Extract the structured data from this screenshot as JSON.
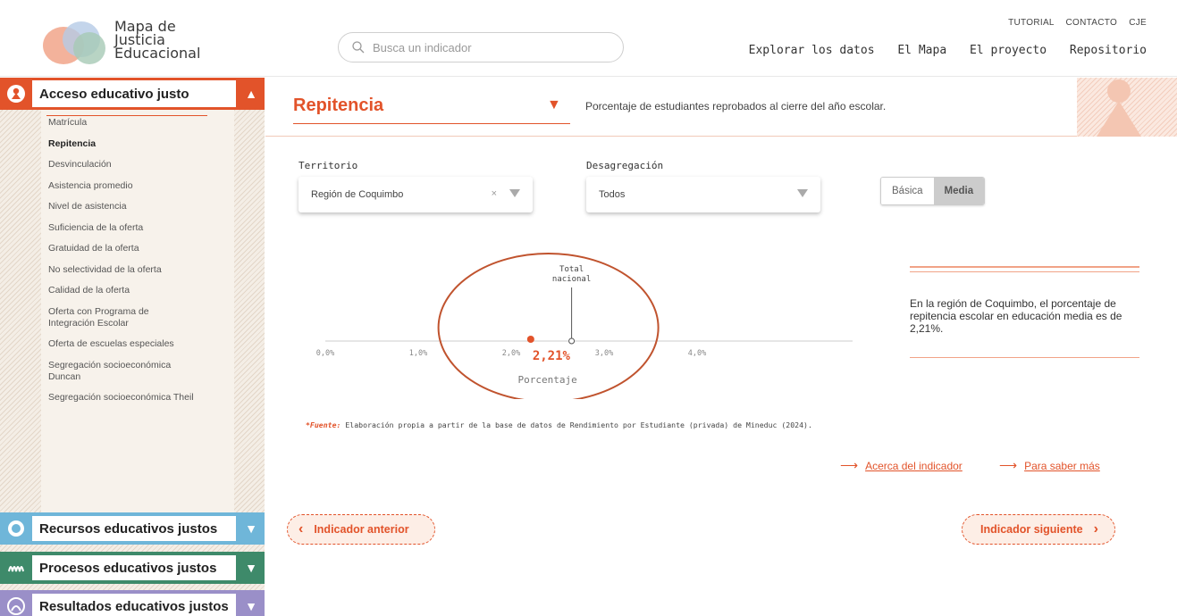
{
  "header": {
    "logo_lines": [
      "Mapa de",
      "Justicia",
      "Educacional"
    ],
    "search_placeholder": "Busca un indicador",
    "top_links": [
      "TUTORIAL",
      "CONTACTO",
      "CJE"
    ],
    "main_nav": [
      "Explorar los datos",
      "El Mapa",
      "El proyecto",
      "Repositorio"
    ]
  },
  "sidebar": {
    "categories": [
      {
        "label": "Acceso educativo justo",
        "color": "#e2532a",
        "expanded": true
      },
      {
        "label": "Recursos educativos justos",
        "color": "#6fb6d9",
        "expanded": false
      },
      {
        "label": "Procesos educativos justos",
        "color": "#3e8a6a",
        "expanded": false
      },
      {
        "label": "Resultados educativos justos",
        "color": "#9a8fc8",
        "expanded": false
      }
    ],
    "items": [
      "Matrícula",
      "Repitencia",
      "Desvinculación",
      "Asistencia promedio",
      "Nivel de asistencia",
      "Suficiencia de la oferta",
      "Gratuidad de la oferta",
      "No selectividad de la oferta",
      "Calidad de la oferta",
      "Oferta con Programa de Integración Escolar",
      "Oferta de escuelas especiales",
      "Segregación socioeconómica Duncan",
      "Segregación socioeconómica Theil"
    ],
    "active_item": "Repitencia"
  },
  "indicator": {
    "title": "Repitencia",
    "description": "Porcentaje de estudiantes reprobados al cierre del año escolar."
  },
  "filters": {
    "territorio_label": "Territorio",
    "territorio_value": "Región de Coquimbo",
    "clear_symbol": "×",
    "desagregacion_label": "Desagregación",
    "desagregacion_value": "Todos",
    "level_options": [
      "Básica",
      "Media"
    ],
    "level_selected": "Media"
  },
  "chart_data": {
    "type": "scatter",
    "xlabel": "Porcentaje",
    "tick_labels": [
      "0,0%",
      "1,0%",
      "2,0%",
      "3,0%",
      "4,0%"
    ],
    "ticks": [
      0,
      1,
      2,
      3,
      4
    ],
    "xlim": [
      0,
      5
    ],
    "points": [
      {
        "label": "2,21%",
        "value": 2.21,
        "color": "#e2532a"
      }
    ],
    "reference": {
      "label_lines": [
        "Total",
        "nacional"
      ],
      "value": 2.65
    }
  },
  "summary": {
    "text": "En la región de Coquimbo, el porcentaje de repitencia escolar en educación media es de 2,21%."
  },
  "source": {
    "label": "*Fuente:",
    "text": " Elaboración propia a partir de la base de datos de Rendimiento por Estudiante (privada) de Mineduc (2024)."
  },
  "links": {
    "about": "Acerca del indicador",
    "more": "Para saber más"
  },
  "nav": {
    "prev": "Indicador anterior",
    "next": "Indicador siguiente"
  },
  "colors": {
    "accent": "#e2532a",
    "annotation_circle": "#c0532e"
  }
}
